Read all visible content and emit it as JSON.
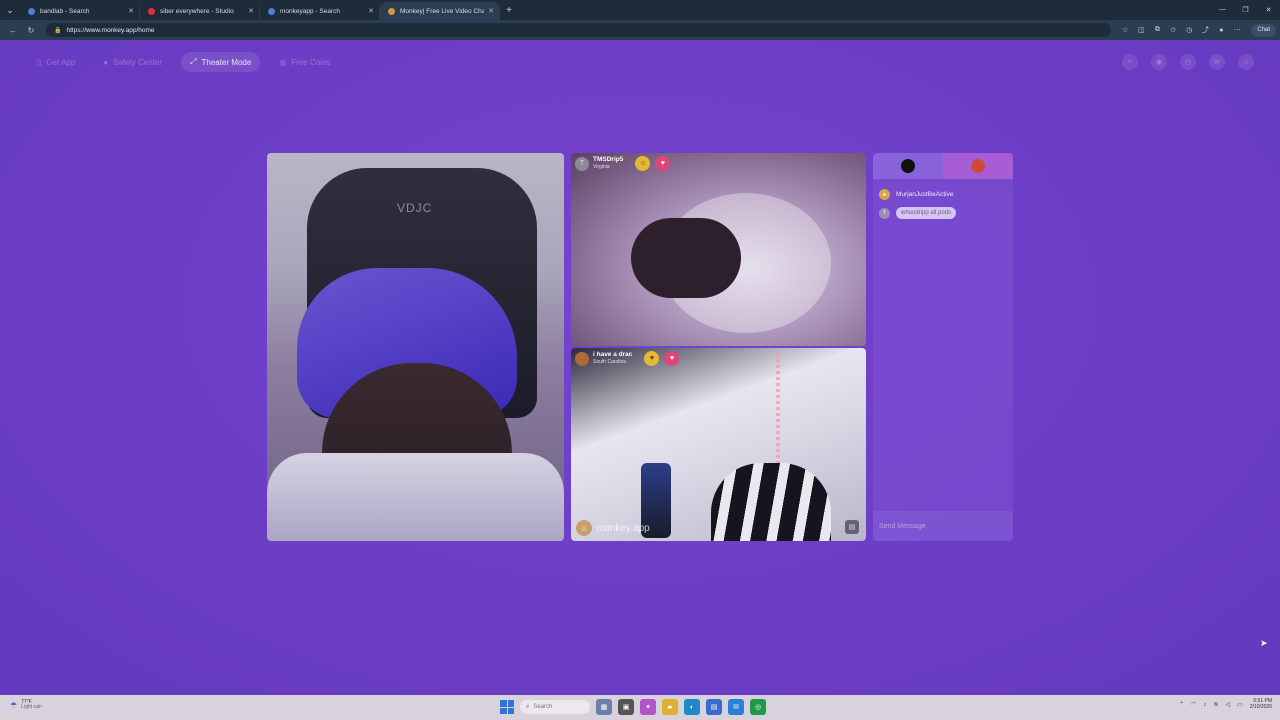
{
  "browser": {
    "tabs": [
      {
        "title": "bandlab - Search",
        "color": "#4f7fd1",
        "active": false
      },
      {
        "title": "siber everywhere - Studio",
        "color": "#e0303a",
        "active": false
      },
      {
        "title": "monkeyapp - Search",
        "color": "#4f7fd1",
        "active": false
      },
      {
        "title": "Monkey| Free Live Video Cha",
        "color": "#d59a3a",
        "active": true
      }
    ],
    "new_tab": "+",
    "url": "https://www.monkey.app/home",
    "chat_button": "Chat"
  },
  "nav": {
    "get_app": "Get App",
    "safety_center": "Safety Center",
    "theater_mode": "Theater Mode",
    "free_coins": "Free Coins"
  },
  "main_video": {
    "chair_logo": "VDJC"
  },
  "tiles": [
    {
      "avatar_letter": "T",
      "username": "TMSDrip5",
      "location": "Virginia"
    },
    {
      "avatar_letter": "",
      "username": "i have a drac",
      "location": "South Carolina"
    }
  ],
  "watermark": "monkey.app",
  "chat": {
    "peer_letter": "T",
    "system_name": "MurjanJustBeActive",
    "message": "whoodripp all pods",
    "message_avatar_letter": "T",
    "input_placeholder": "Send Message"
  },
  "taskbar": {
    "weather_temp": "77°F",
    "weather_desc": "Light rain",
    "search_placeholder": "Search",
    "time": "6:51 PM",
    "date": "2/10/2026"
  },
  "colors": {
    "page_bg": "#6d3ec8",
    "badge_gold": "#e2b932",
    "badge_pink": "#e0457a"
  }
}
